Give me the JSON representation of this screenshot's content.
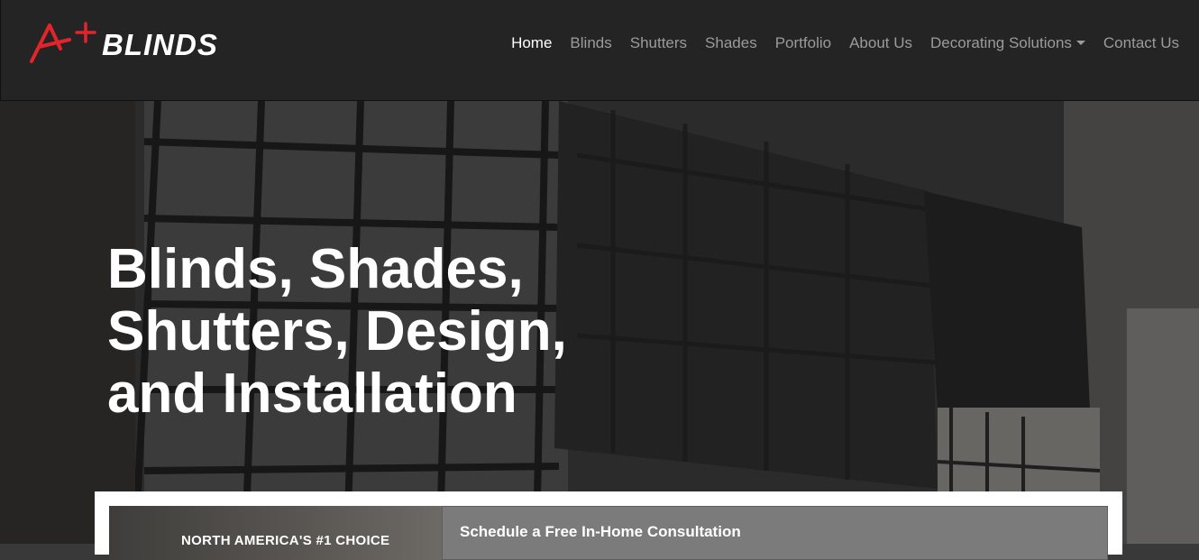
{
  "brand": {
    "logo_mark": "A+",
    "logo_word": "BLINDS",
    "accent_color": "#e3242b"
  },
  "nav": {
    "items": [
      {
        "label": "Home",
        "active": true
      },
      {
        "label": "Blinds",
        "active": false
      },
      {
        "label": "Shutters",
        "active": false
      },
      {
        "label": "Shades",
        "active": false
      },
      {
        "label": "Portfolio",
        "active": false
      },
      {
        "label": "About Us",
        "active": false
      },
      {
        "label": "Decorating Solutions",
        "active": false,
        "dropdown": true
      },
      {
        "label": "Contact Us",
        "active": false
      }
    ]
  },
  "hero": {
    "title_line1": "Blinds, Shades,",
    "title_line2": "Shutters, Design,",
    "title_line3": "and Installation"
  },
  "card": {
    "kicker": "NORTH AMERICA'S #1 CHOICE",
    "form_title": "Schedule a Free In-Home Consultation"
  }
}
